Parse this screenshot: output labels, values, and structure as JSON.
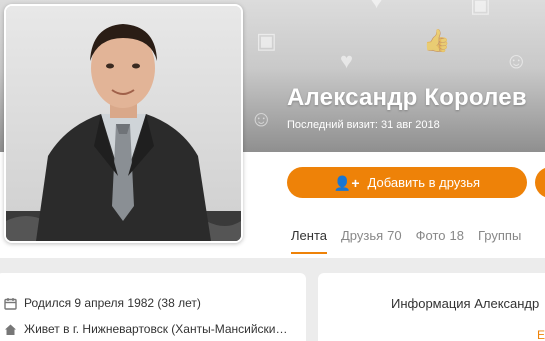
{
  "profile": {
    "name": "Александр Королев",
    "last_visit": "Последний визит: 31 авг 2018",
    "add_friend_label": "Добавить в друзья"
  },
  "tabs": [
    {
      "label": "Лента",
      "count": ""
    },
    {
      "label": "Друзья",
      "count": "70"
    },
    {
      "label": "Фото",
      "count": "18"
    },
    {
      "label": "Группы",
      "count": ""
    }
  ],
  "about": {
    "birth": "Родился 9 апреля 1982 (38 лет)",
    "lives": "Живет в г. Нижневартовск (Ханты-Мансийски…"
  },
  "info_card": {
    "title": "Информация Александр",
    "more": "Е"
  },
  "colors": {
    "accent": "#ee8208",
    "text": "#333333",
    "muted": "#888888"
  },
  "icons": [
    "photo-icon",
    "like-icon",
    "heart-icon",
    "smile-icon",
    "user-plus-icon",
    "calendar-icon",
    "home-icon"
  ]
}
